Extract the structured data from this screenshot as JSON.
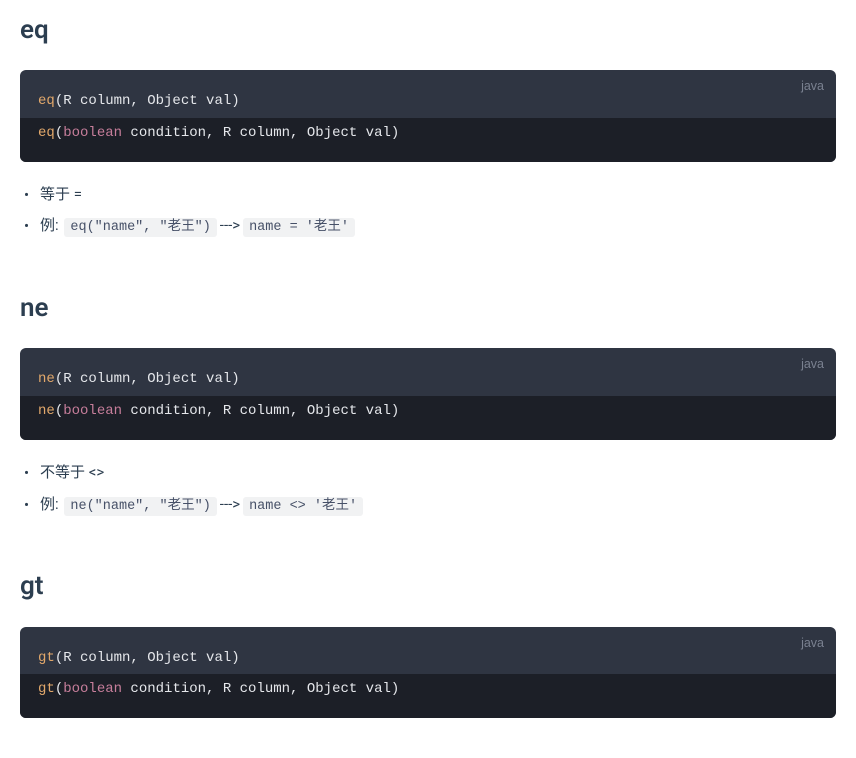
{
  "sections": [
    {
      "id": "eq",
      "heading": "eq",
      "code": {
        "lang": "java",
        "lines": [
          {
            "parts": [
              {
                "t": "method",
                "v": "eq"
              },
              {
                "t": "plain",
                "v": "(R column, Object val)"
              }
            ],
            "hl": false
          },
          {
            "parts": [
              {
                "t": "method",
                "v": "eq"
              },
              {
                "t": "plain",
                "v": "("
              },
              {
                "t": "keyword",
                "v": "boolean"
              },
              {
                "t": "plain",
                "v": " condition, R column, Object val)"
              }
            ],
            "hl": true
          }
        ]
      },
      "bullets": [
        {
          "type": "plain",
          "text": "等于 ="
        },
        {
          "type": "example",
          "label": "例:",
          "code1": "eq(\"name\", \"老王\")",
          "arrow": "--->",
          "code2": "name = '老王'"
        }
      ]
    },
    {
      "id": "ne",
      "heading": "ne",
      "code": {
        "lang": "java",
        "lines": [
          {
            "parts": [
              {
                "t": "method",
                "v": "ne"
              },
              {
                "t": "plain",
                "v": "(R column, Object val)"
              }
            ],
            "hl": false
          },
          {
            "parts": [
              {
                "t": "method",
                "v": "ne"
              },
              {
                "t": "plain",
                "v": "("
              },
              {
                "t": "keyword",
                "v": "boolean"
              },
              {
                "t": "plain",
                "v": " condition, R column, Object val)"
              }
            ],
            "hl": true
          }
        ]
      },
      "bullets": [
        {
          "type": "plain",
          "text": "不等于 <>"
        },
        {
          "type": "example",
          "label": "例:",
          "code1": "ne(\"name\", \"老王\")",
          "arrow": "--->",
          "code2": "name <> '老王'"
        }
      ]
    },
    {
      "id": "gt",
      "heading": "gt",
      "code": {
        "lang": "java",
        "lines": [
          {
            "parts": [
              {
                "t": "method",
                "v": "gt"
              },
              {
                "t": "plain",
                "v": "(R column, Object val)"
              }
            ],
            "hl": false
          },
          {
            "parts": [
              {
                "t": "method",
                "v": "gt"
              },
              {
                "t": "plain",
                "v": "("
              },
              {
                "t": "keyword",
                "v": "boolean"
              },
              {
                "t": "plain",
                "v": " condition, R column, Object val)"
              }
            ],
            "hl": true
          }
        ]
      },
      "bullets": []
    }
  ]
}
